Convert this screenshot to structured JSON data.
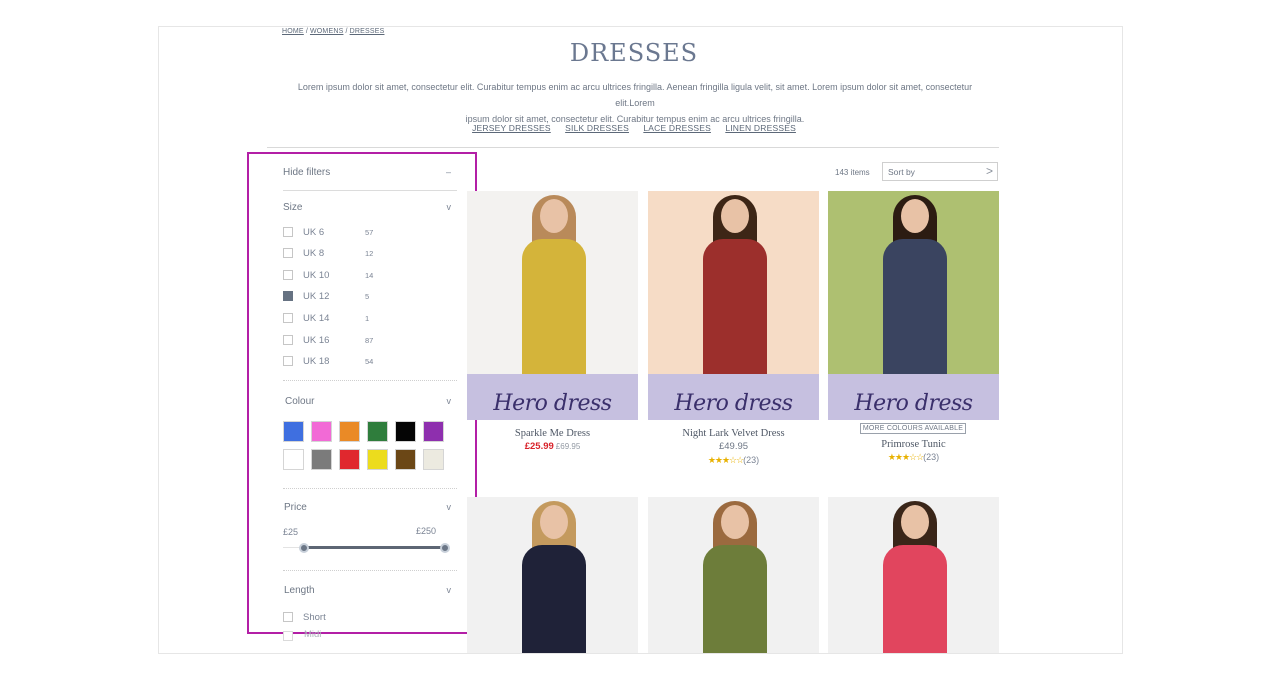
{
  "breadcrumb": {
    "home": "HOME",
    "womens": "WOMENS",
    "dresses": "DRESSES",
    "sep": "/"
  },
  "page": {
    "title": "DRESSES",
    "intro_line1": "Lorem ipsum dolor sit amet, consectetur elit. Curabitur tempus enim ac arcu ultrices fringilla. Aenean fringilla ligula velit, sit amet. Lorem ipsum dolor sit amet, consectetur elit.Lorem",
    "intro_line2": "ipsum dolor sit amet, consectetur elit. Curabitur tempus enim ac arcu ultrices fringilla."
  },
  "subcategories": [
    "JERSEY DRESSES",
    "SILK DRESSES",
    "LACE DRESSES",
    "LINEN DRESSES"
  ],
  "filters": {
    "hide_label": "Hide filters",
    "hide_symbol": "–",
    "size": {
      "label": "Size",
      "options": [
        {
          "label": "UK 6",
          "count": "57",
          "checked": false
        },
        {
          "label": "UK 8",
          "count": "12",
          "checked": false
        },
        {
          "label": "UK 10",
          "count": "14",
          "checked": false
        },
        {
          "label": "UK 12",
          "count": "5",
          "checked": true
        },
        {
          "label": "UK 14",
          "count": "1",
          "checked": false
        },
        {
          "label": "UK 16",
          "count": "87",
          "checked": false
        },
        {
          "label": "UK 18",
          "count": "54",
          "checked": false
        }
      ]
    },
    "colour": {
      "label": "Colour",
      "swatches": [
        "#3f6fe0",
        "#f26ad6",
        "#ea8a26",
        "#2f7d3c",
        "#050505",
        "#8e2fae",
        "#ffffff",
        "#7b7b7b",
        "#e0282e",
        "#ecdc1d",
        "#6b4716",
        "#eceae0"
      ]
    },
    "price": {
      "label": "Price",
      "min": "£25",
      "max": "£250"
    },
    "length": {
      "label": "Length",
      "options": [
        "Short",
        "Midi"
      ]
    },
    "chevron": "v"
  },
  "listing": {
    "items_count": "143 items",
    "sort_label": "Sort by",
    "sort_arrow": ">"
  },
  "hero_label": "Hero dress",
  "products": [
    {
      "name": "Sparkle Me Dress",
      "sale_price": "£25.99",
      "was_price": "£69.95",
      "rating_stars": "",
      "reviews": "",
      "badge": "",
      "bg": "#f3f2f0",
      "dress": "#d4b43a",
      "hair": "#b98a5a"
    },
    {
      "name": "Night Lark Velvet Dress",
      "price": "£49.95",
      "rating_stars": "★★★☆☆",
      "reviews": "(23)",
      "bg": "#f6dcc6",
      "dress": "#9c2f2c",
      "hair": "#3d2616"
    },
    {
      "name": "Primrose Tunic",
      "badge": "MORE COLOURS AVAILABLE",
      "rating_stars": "★★★☆☆",
      "reviews": "(23)",
      "bg": "#aec071",
      "dress": "#3a4460",
      "hair": "#2c1c12"
    },
    {
      "bg": "#f1f1f1",
      "dress": "#1f2238",
      "hair": "#c49a5e"
    },
    {
      "bg": "#f1f1f1",
      "dress": "#6d7d3a",
      "hair": "#9b6a3f"
    },
    {
      "bg": "#f1f1f1",
      "dress": "#e1455e",
      "hair": "#3a2619"
    }
  ]
}
